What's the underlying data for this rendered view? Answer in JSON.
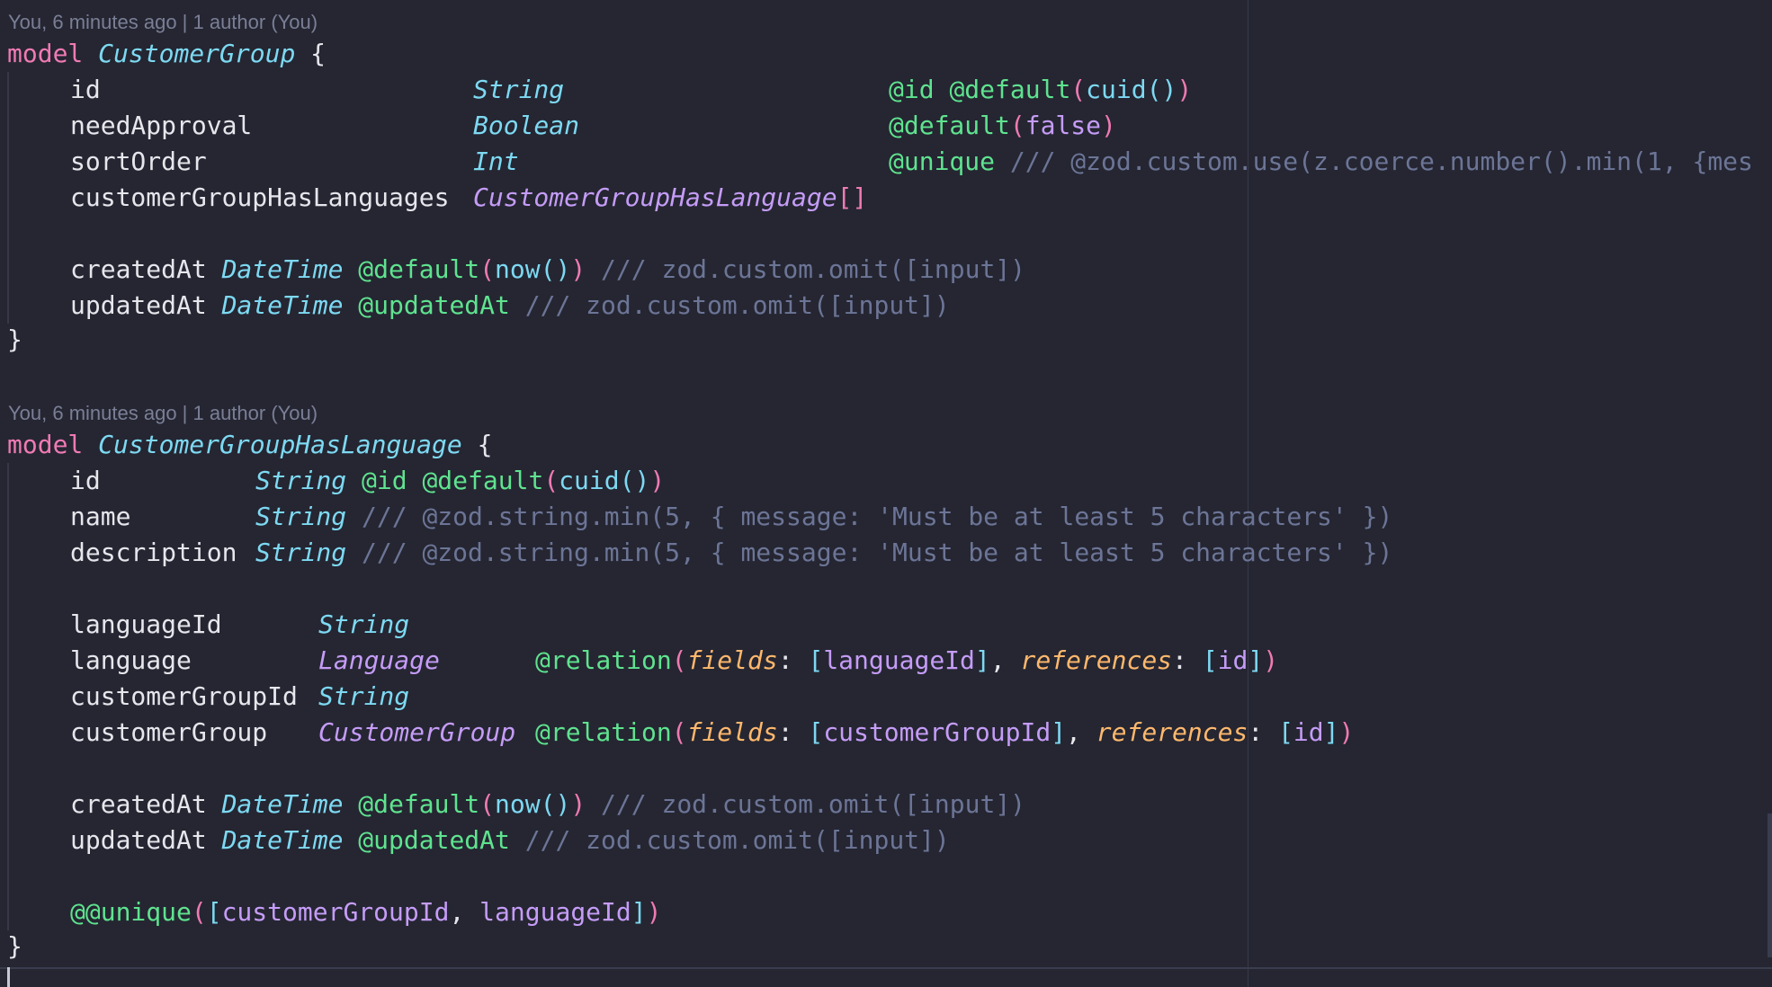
{
  "code_lens": {
    "first": "You, 6 minutes ago | 1 author (You)",
    "second": "You, 6 minutes ago | 1 author (You)"
  },
  "customer_group": {
    "keyword": "model",
    "name": "CustomerGroup",
    "open": "{",
    "close": "}",
    "fields": {
      "id": {
        "name": "id",
        "type": "String",
        "attr1": "@id",
        "attr2": "@default",
        "p_open": "(",
        "fn": "cuid",
        "fn_parens": "()",
        "p_close": ")"
      },
      "need_approval": {
        "name": "needApproval",
        "type": "Boolean",
        "attr": "@default",
        "p_open": "(",
        "value": "false",
        "p_close": ")"
      },
      "sort_order": {
        "name": "sortOrder",
        "type": "Int",
        "attr": "@unique",
        "comment": "/// @zod.custom.use(z.coerce.number().min(1, {mes"
      },
      "languages": {
        "name": "customerGroupHasLanguages",
        "type": "CustomerGroupHasLanguage",
        "array": "[]"
      },
      "created_at": {
        "name": "createdAt",
        "type": "DateTime",
        "attr": "@default",
        "p_open": "(",
        "fn": "now",
        "fn_parens": "()",
        "p_close": ")",
        "comment": "/// zod.custom.omit([input])"
      },
      "updated_at": {
        "name": "updatedAt",
        "type": "DateTime",
        "attr": "@updatedAt",
        "comment": "/// zod.custom.omit([input])"
      }
    }
  },
  "customer_group_has_language": {
    "keyword": "model",
    "name": "CustomerGroupHasLanguage",
    "open": "{",
    "close": "}",
    "fields": {
      "id": {
        "name": "id",
        "type": "String",
        "attr1": "@id",
        "attr2": "@default",
        "p_open": "(",
        "fn": "cuid",
        "fn_parens": "()",
        "p_close": ")"
      },
      "name": {
        "name": "name",
        "type": "String",
        "comment": "/// @zod.string.min(5, { message: 'Must be at least 5 characters' })"
      },
      "description": {
        "name": "description",
        "type": "String",
        "comment": "/// @zod.string.min(5, { message: 'Must be at least 5 characters' })"
      },
      "language_id": {
        "name": "languageId",
        "type": "String"
      },
      "language": {
        "name": "language",
        "type": "Language",
        "attr": "@relation",
        "p_open": "(",
        "arg1": "fields",
        "colon": ":",
        "b_open": "[",
        "val1": "languageId",
        "b_close": "]",
        "comma": ",",
        "arg2": "references",
        "val2": "id",
        "p_close": ")"
      },
      "customer_group_id": {
        "name": "customerGroupId",
        "type": "String"
      },
      "customer_group": {
        "name": "customerGroup",
        "type": "CustomerGroup",
        "attr": "@relation",
        "p_open": "(",
        "arg1": "fields",
        "colon": ":",
        "b_open": "[",
        "val1": "customerGroupId",
        "b_close": "]",
        "comma": ",",
        "arg2": "references",
        "val2": "id",
        "p_close": ")"
      },
      "created_at": {
        "name": "createdAt",
        "type": "DateTime",
        "attr": "@default",
        "p_open": "(",
        "fn": "now",
        "fn_parens": "()",
        "p_close": ")",
        "comment": "/// zod.custom.omit([input])"
      },
      "updated_at": {
        "name": "updatedAt",
        "type": "DateTime",
        "attr": "@updatedAt",
        "comment": "/// zod.custom.omit([input])"
      },
      "unique_block": {
        "attr": "@@unique",
        "p_open": "(",
        "b_open": "[",
        "val1": "customerGroupId",
        "comma": ",",
        "val2": "languageId",
        "b_close": "]",
        "p_close": ")"
      }
    }
  }
}
